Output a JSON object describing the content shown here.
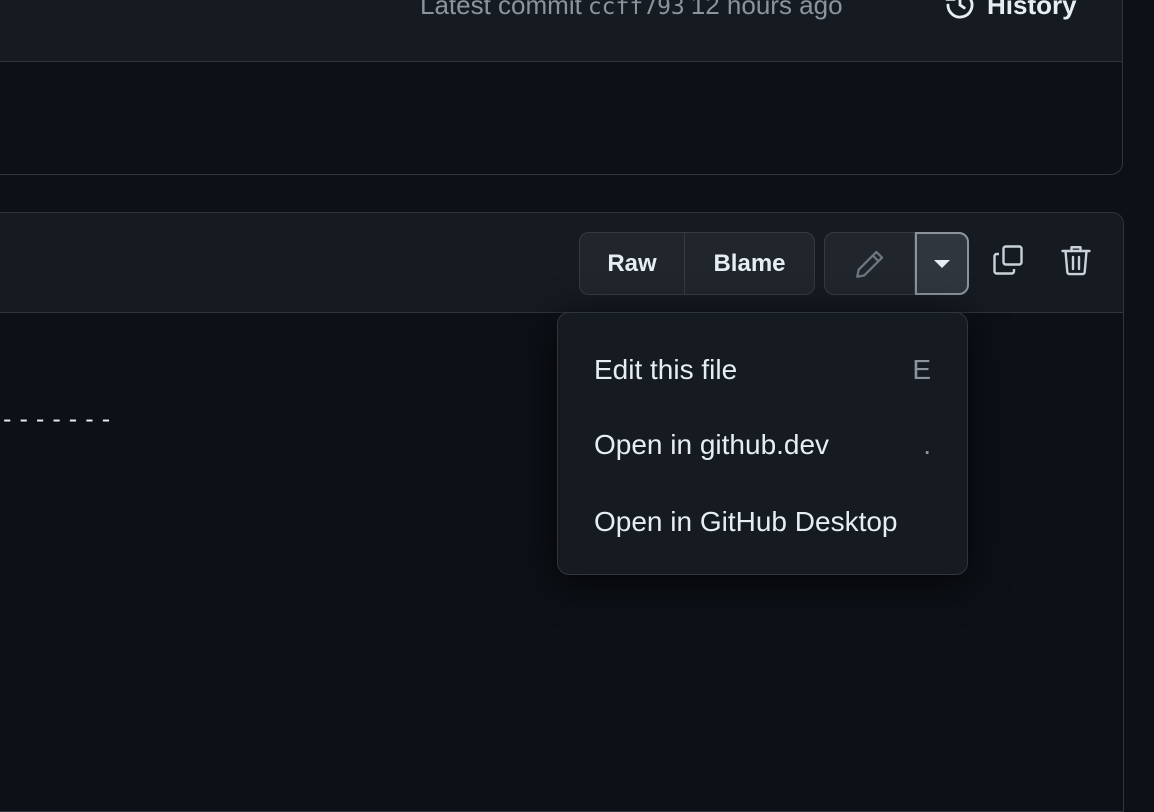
{
  "commit": {
    "prefix": "Latest commit",
    "sha": "ccff793",
    "time": "12 hours ago"
  },
  "history_label": "History",
  "file_toolbar": {
    "raw_label": "Raw",
    "blame_label": "Blame"
  },
  "code": {
    "line": "-------"
  },
  "menu": {
    "items": [
      {
        "label": "Edit this file",
        "shortcut": "E"
      },
      {
        "label": "Open in github.dev",
        "shortcut": "."
      },
      {
        "label": "Open in GitHub Desktop",
        "shortcut": ""
      }
    ]
  },
  "icons": {
    "history": "history-icon",
    "edit": "pencil-icon",
    "dropdown": "triangle-down-icon",
    "copy": "copy-icon",
    "delete": "trash-icon"
  },
  "colors": {
    "background": "#0d1117",
    "header": "#161b22",
    "border": "#30363d",
    "text": "#e6edf3",
    "muted": "#8b949e"
  }
}
